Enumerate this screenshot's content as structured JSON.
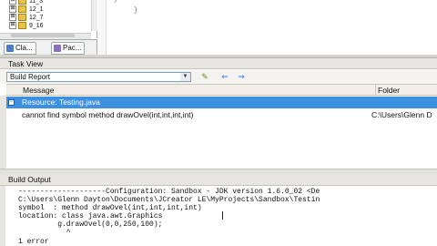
{
  "project_tree": {
    "items": [
      {
        "expander": "⊞",
        "label": "11_3"
      },
      {
        "expander": "⊞",
        "label": "12_1"
      },
      {
        "expander": "⊞",
        "label": "12_7"
      },
      {
        "expander": "⊞",
        "label": "9_16"
      }
    ]
  },
  "left_tabs": [
    {
      "label": "Cla..."
    },
    {
      "label": "Pac..."
    }
  ],
  "editor": {
    "snippet_lines": [
      "}",
      "}"
    ]
  },
  "task_view": {
    "title": "Task View",
    "filter_selected": "Build Report",
    "filter_arrow": "▼",
    "columns": {
      "message": "Message",
      "folder": "Folder"
    },
    "group_row": {
      "toggle": "−",
      "label": "Resource: Testing.java"
    },
    "rows": [
      {
        "message": "cannot find symbol method drawOvel(int,int,int,int)",
        "folder": "C:\\Users\\Glenn D"
      }
    ],
    "toolbar_icons": {
      "edit": "✎",
      "prev": "⇐",
      "next": "⇒"
    }
  },
  "build_output": {
    "title": "Build Output",
    "lines": [
      "--------------------Configuration: Sandbox - JDK version 1.6.0_02 <De",
      "C:\\Users\\Glenn Dayton\\Documents\\JCreator LE\\MyProjects\\Sandbox\\Testin",
      "symbol  : method drawOvel(int,int,int,int)",
      "location: class java.awt.Graphics",
      "         g.drawOvel(0,0,250,100);",
      "           ^",
      "1 error"
    ]
  },
  "colors": {
    "selection": "#3d8fe0",
    "panel": "#e8e6e0"
  }
}
